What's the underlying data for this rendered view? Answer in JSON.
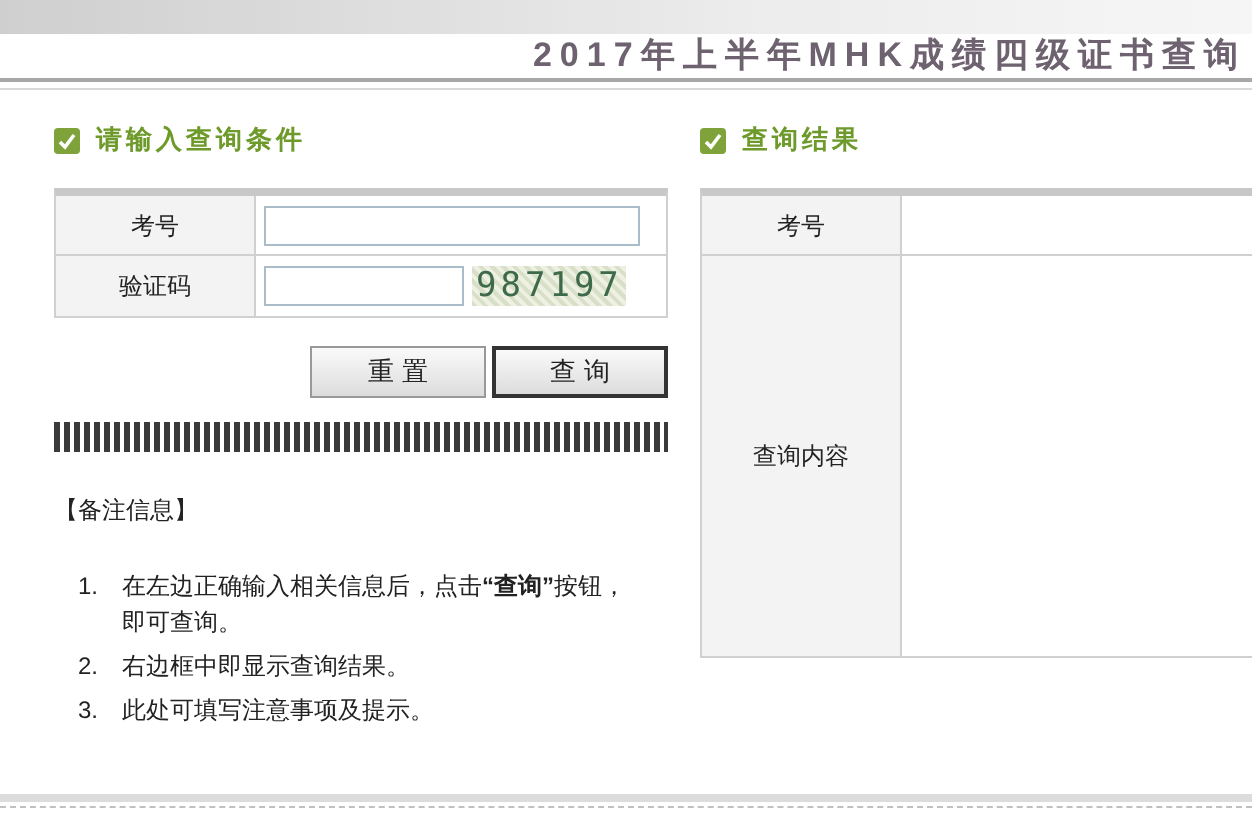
{
  "title": "2017年上半年MHK成绩四级证书查询",
  "query_panel": {
    "heading": "请输入查询条件",
    "fields": [
      {
        "label": "考号",
        "kind": "text"
      },
      {
        "label": "验证码",
        "kind": "captcha",
        "captcha": "987197"
      }
    ],
    "buttons": [
      {
        "label": "重 置",
        "kind": "default"
      },
      {
        "label": "查 询",
        "kind": "primary"
      }
    ]
  },
  "notes": {
    "heading": "【备注信息】",
    "items": [
      {
        "number": "1.",
        "text": "在左边正确输入相关信息后，点击**“查询”**按钮，即可查询。"
      },
      {
        "number": "2.",
        "text": "右边框中即显示查询结果。"
      },
      {
        "number": "3.",
        "text": "此处可填写注意事项及提示。"
      }
    ]
  },
  "result_panel": {
    "heading": "查询结果",
    "rows": [
      {
        "label": "考号",
        "kind": "short"
      },
      {
        "label": "查询内容",
        "kind": "tall"
      }
    ]
  }
}
